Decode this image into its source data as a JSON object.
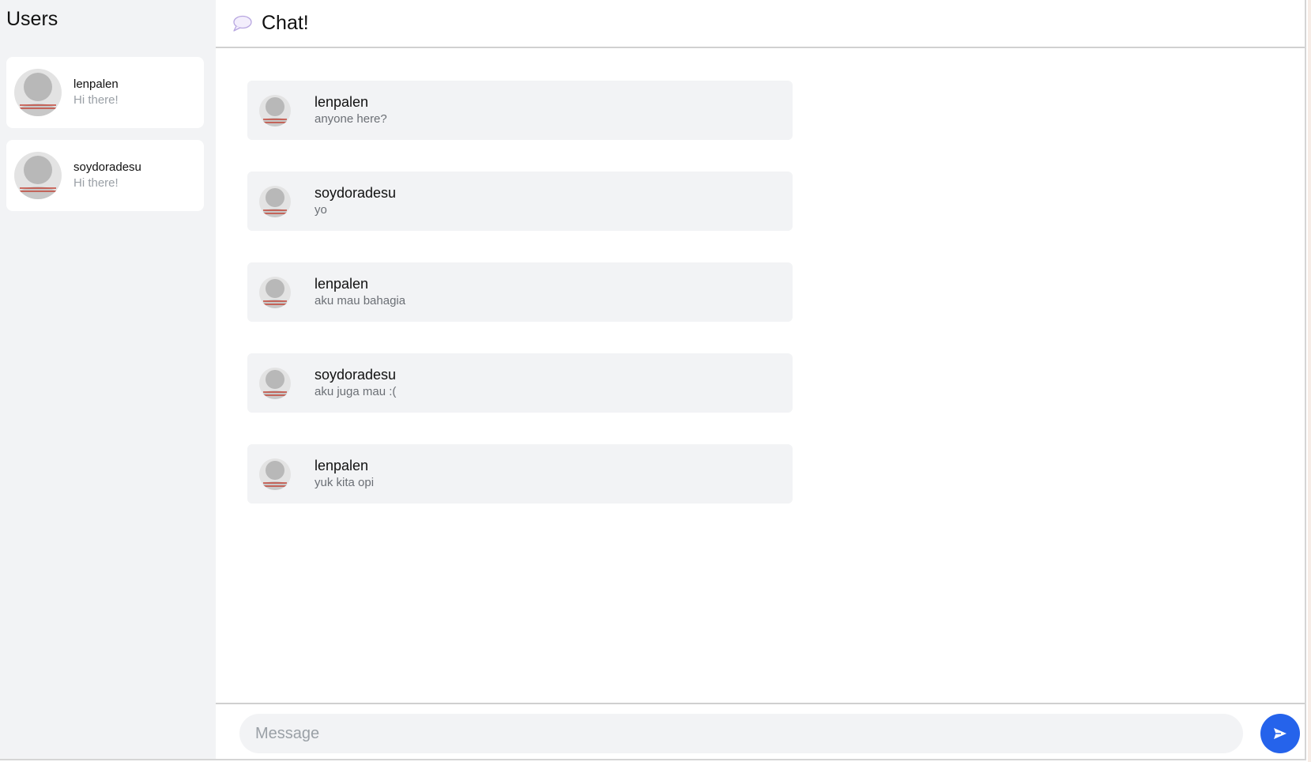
{
  "sidebar": {
    "title": "Users",
    "users": [
      {
        "name": "lenpalen",
        "preview": "Hi there!"
      },
      {
        "name": "soydoradesu",
        "preview": "Hi there!"
      }
    ]
  },
  "header": {
    "title": "Chat!",
    "icon": "speech-bubble-icon"
  },
  "messages": [
    {
      "sender": "lenpalen",
      "text": "anyone here?"
    },
    {
      "sender": "soydoradesu",
      "text": "yo"
    },
    {
      "sender": "lenpalen",
      "text": "aku mau bahagia"
    },
    {
      "sender": "soydoradesu",
      "text": "aku juga mau :("
    },
    {
      "sender": "lenpalen",
      "text": "yuk kita opi"
    }
  ],
  "composer": {
    "placeholder": "Message",
    "value": "",
    "send_icon": "send-icon"
  },
  "colors": {
    "accent": "#2563eb",
    "sidebar_bg": "#f2f3f5",
    "bubble_bg": "#f2f3f5",
    "muted_text": "#9aa0a6"
  }
}
